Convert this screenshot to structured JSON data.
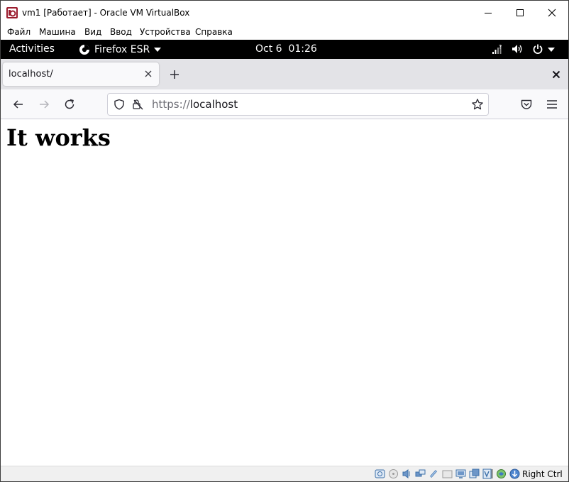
{
  "vbox": {
    "title": "vm1 [Работает] - Oracle VM VirtualBox",
    "menu": [
      "Файл",
      "Машина",
      "Вид",
      "Ввод",
      "Устройства",
      "Справка"
    ],
    "host_key": "Right Ctrl"
  },
  "gnome": {
    "activities": "Activities",
    "app_name": "Firefox ESR",
    "clock": "Oct 6  01:26"
  },
  "browser": {
    "tab_title": "localhost/",
    "url_scheme": "https://",
    "url_host": "localhost"
  },
  "page": {
    "heading": "It works"
  },
  "colors": {
    "gnome_bar": "#000000",
    "tab_strip": "#e3e3e7",
    "nav_bar": "#f9f9fb",
    "status_bar": "#f0f0f0"
  }
}
